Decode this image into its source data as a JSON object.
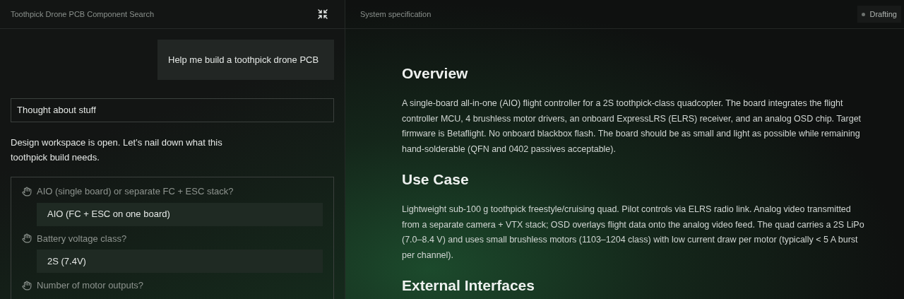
{
  "chat": {
    "title": "Toothpick Drone PCB Component Search",
    "user_message": "Help me build a toothpick drone PCB",
    "thought": "Thought about stuff",
    "reply": "Design workspace is open. Let’s nail down what this toothpick build needs.",
    "questions": [
      {
        "question": "AIO (single board) or separate FC + ESC stack?",
        "answer": "AIO (FC + ESC on one board)"
      },
      {
        "question": "Battery voltage class?",
        "answer": "2S (7.4V)"
      },
      {
        "question": "Number of motor outputs?"
      }
    ]
  },
  "spec": {
    "title": "System specification",
    "status": "Drafting",
    "sections": [
      {
        "heading": "Overview",
        "body": "A single-board all-in-one (AIO) flight controller for a 2S toothpick-class quadcopter. The board integrates the flight controller MCU, 4 brushless motor drivers, an onboard ExpressLRS (ELRS) receiver, and an analog OSD chip. Target firmware is Betaflight. No onboard blackbox flash. The board should be as small and light as possible while remaining hand-solderable (QFN and 0402 passives acceptable)."
      },
      {
        "heading": "Use Case",
        "body": "Lightweight sub-100 g toothpick freestyle/cruising quad. Pilot controls via ELRS radio link. Analog video transmitted from a separate camera + VTX stack; OSD overlays flight data onto the analog video feed. The quad carries a 2S LiPo (7.0–8.4 V) and uses small brushless motors (1103–1204 class) with low current draw per motor (typically < 5 A burst per channel)."
      },
      {
        "heading": "External Interfaces"
      }
    ]
  }
}
